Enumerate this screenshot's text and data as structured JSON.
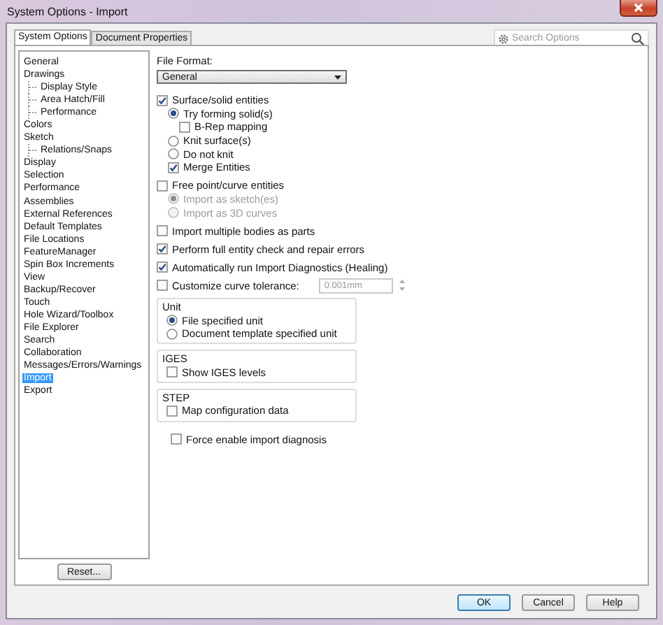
{
  "window": {
    "title": "System Options - Import"
  },
  "tabs": [
    {
      "label": "System Options",
      "selected": true
    },
    {
      "label": "Document Properties",
      "selected": false
    }
  ],
  "search": {
    "placeholder": "Search Options"
  },
  "tree": [
    {
      "label": "General",
      "selected": false
    },
    {
      "label": "Drawings",
      "selected": false,
      "children": [
        {
          "label": "Display Style",
          "selected": false
        },
        {
          "label": "Area Hatch/Fill",
          "selected": false
        },
        {
          "label": "Performance",
          "selected": false
        }
      ]
    },
    {
      "label": "Colors",
      "selected": false
    },
    {
      "label": "Sketch",
      "selected": false,
      "children": [
        {
          "label": "Relations/Snaps",
          "selected": false
        }
      ]
    },
    {
      "label": "Display",
      "selected": false
    },
    {
      "label": "Selection",
      "selected": false
    },
    {
      "label": "Performance",
      "selected": false
    },
    {
      "label": "Assemblies",
      "selected": false
    },
    {
      "label": "External References",
      "selected": false
    },
    {
      "label": "Default Templates",
      "selected": false
    },
    {
      "label": "File Locations",
      "selected": false
    },
    {
      "label": "FeatureManager",
      "selected": false
    },
    {
      "label": "Spin Box Increments",
      "selected": false
    },
    {
      "label": "View",
      "selected": false
    },
    {
      "label": "Backup/Recover",
      "selected": false
    },
    {
      "label": "Touch",
      "selected": false
    },
    {
      "label": "Hole Wizard/Toolbox",
      "selected": false
    },
    {
      "label": "File Explorer",
      "selected": false
    },
    {
      "label": "Search",
      "selected": false
    },
    {
      "label": "Collaboration",
      "selected": false
    },
    {
      "label": "Messages/Errors/Warnings",
      "selected": false
    },
    {
      "label": "Import",
      "selected": true
    },
    {
      "label": "Export",
      "selected": false
    }
  ],
  "file_format": {
    "label": "File Format:",
    "value": "General"
  },
  "options": [
    {
      "kind": "checkbox",
      "label": "Surface/solid entities",
      "checked": true,
      "disabled": false,
      "children": [
        {
          "kind": "radio",
          "label": "Try forming solid(s)",
          "selected": true,
          "disabled": false,
          "children": [
            {
              "kind": "checkbox",
              "label": "B-Rep mapping",
              "checked": false,
              "disabled": false
            }
          ]
        },
        {
          "kind": "radio",
          "label": "Knit surface(s)",
          "selected": false,
          "disabled": false
        },
        {
          "kind": "radio",
          "label": "Do not knit",
          "selected": false,
          "disabled": false
        },
        {
          "kind": "checkbox",
          "label": "Merge Entities",
          "checked": true,
          "disabled": false
        }
      ]
    },
    {
      "kind": "checkbox",
      "label": "Free point/curve entities",
      "checked": false,
      "disabled": false,
      "children": [
        {
          "kind": "radio",
          "label": "Import as sketch(es)",
          "selected": true,
          "disabled": true
        },
        {
          "kind": "radio",
          "label": "Import as 3D curves",
          "selected": false,
          "disabled": true
        }
      ]
    },
    {
      "kind": "checkbox",
      "label": "Import multiple bodies as parts",
      "checked": false,
      "disabled": false
    },
    {
      "kind": "checkbox",
      "label": "Perform full entity check and repair errors",
      "checked": true,
      "disabled": false
    },
    {
      "kind": "checkbox",
      "label": "Automatically run Import Diagnostics (Healing)",
      "checked": true,
      "disabled": false
    },
    {
      "kind": "field",
      "label": "Customize curve tolerance:",
      "checked": false,
      "disabled": true,
      "value": "0.001mm"
    },
    {
      "kind": "group",
      "title": "Unit",
      "children": [
        {
          "kind": "radio",
          "label": "File specified unit",
          "selected": true,
          "disabled": false
        },
        {
          "kind": "radio",
          "label": "Document template specified unit",
          "selected": false,
          "disabled": false
        }
      ]
    },
    {
      "kind": "group",
      "title": "IGES",
      "children": [
        {
          "kind": "checkbox",
          "label": "Show IGES levels",
          "checked": false,
          "disabled": false
        }
      ]
    },
    {
      "kind": "group",
      "title": "STEP",
      "children": [
        {
          "kind": "checkbox",
          "label": "Map configuration data",
          "checked": false,
          "disabled": false
        }
      ]
    },
    {
      "kind": "checkbox",
      "label": "Force enable import diagnosis",
      "checked": false,
      "disabled": false
    }
  ],
  "reset_button": "Reset...",
  "buttons": [
    {
      "label": "OK",
      "selected": true
    },
    {
      "label": "Cancel",
      "selected": false
    },
    {
      "label": "Help",
      "selected": false
    }
  ]
}
